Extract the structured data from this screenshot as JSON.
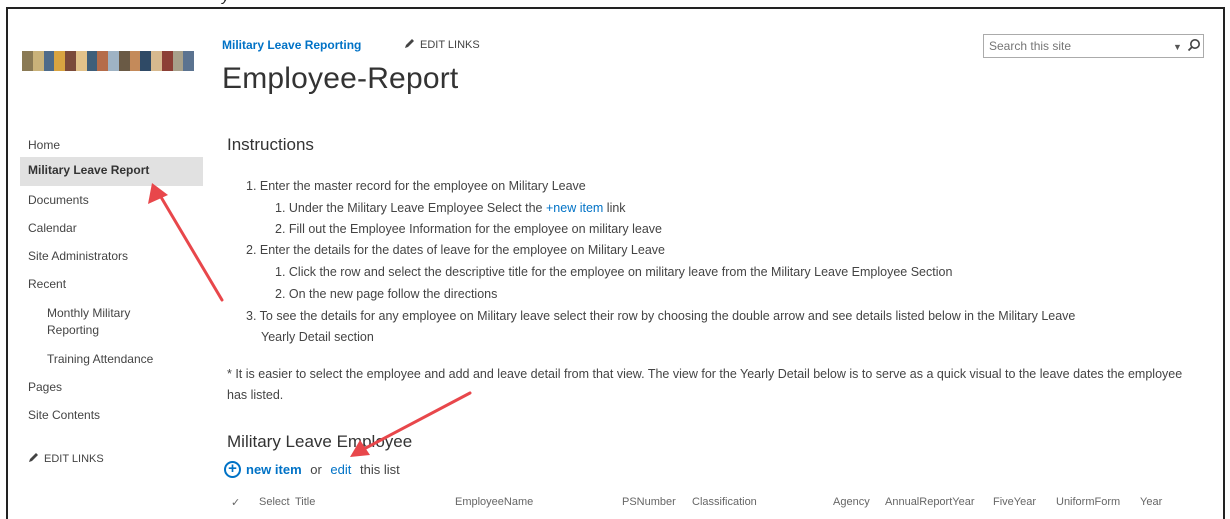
{
  "site": {
    "title": "Military Leave Reporting",
    "edit_links": "EDIT LINKS",
    "page_title": "Employee-Report",
    "search_placeholder": "Search this site"
  },
  "nav": {
    "items": [
      {
        "label": "Home"
      },
      {
        "label": "Military Leave Report",
        "selected": true
      },
      {
        "label": "Documents"
      },
      {
        "label": "Calendar"
      },
      {
        "label": "Site Administrators"
      },
      {
        "label": "Recent"
      },
      {
        "label": "Monthly Military Reporting"
      },
      {
        "label": "Training Attendance"
      },
      {
        "label": "Pages"
      },
      {
        "label": "Site Contents"
      }
    ],
    "edit_links": "EDIT LINKS"
  },
  "instructions": {
    "heading": "Instructions",
    "step1": "1. Enter the master record for the employee on Military Leave",
    "step1_1_pre": "1. Under the Military Leave Employee Select the ",
    "step1_1_link": "+new item",
    "step1_1_post": " link",
    "step1_2": "2. Fill out the Employee Information for the employee on military leave",
    "step2": "2. Enter the details for the dates of leave for the employee on Military Leave",
    "step2_1": "1. Click the row and select the descriptive title for the employee on military leave from the Military Leave Employee Section",
    "step2_2": "2. On the new page follow the directions",
    "step3_line1": "3. To see the details for any employee on Military leave select their row by choosing the double arrow and see details listed below in the Military Leave",
    "step3_line2": "Yearly Detail section",
    "note": "* It is easier to select the employee and add and leave detail from that view.  The view for the Yearly Detail below is to serve as a quick visual to the leave dates the employee has listed."
  },
  "list": {
    "heading": "Military Leave Employee",
    "new_item": "new item",
    "or": " or ",
    "edit": "edit",
    "this_list": " this list",
    "check_mark": "✓",
    "columns": [
      "Select",
      "Title",
      "EmployeeName",
      "PSNumber",
      "Classification",
      "Agency",
      "AnnualReportYear",
      "FiveYear",
      "UniformForm",
      "Year"
    ]
  },
  "colors": {
    "accent": "#0072c6",
    "arrow": "#e8474b",
    "nav_selected": "#e1e1e1"
  },
  "icons": {
    "pencil": "pencil-icon",
    "search": "search-icon",
    "plus": "plus-circle-icon"
  }
}
